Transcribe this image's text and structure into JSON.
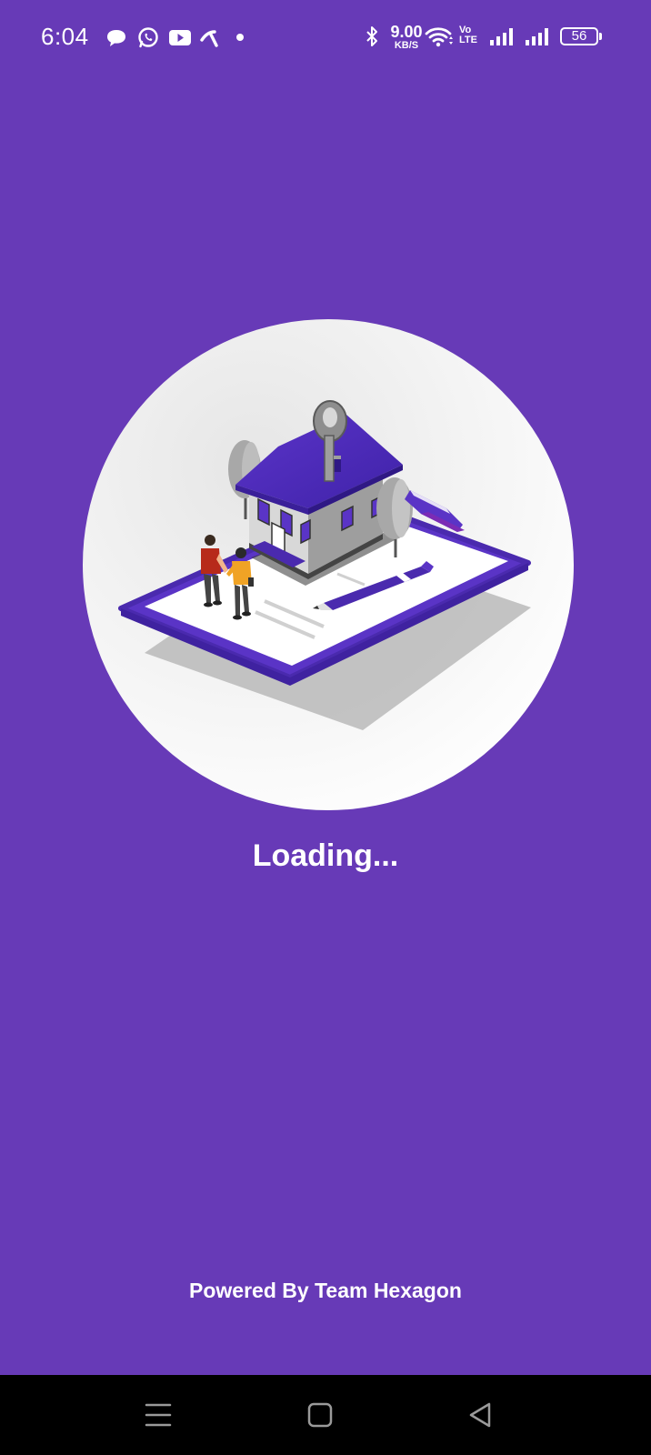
{
  "status_bar": {
    "time": "6:04",
    "net_speed_value": "9.00",
    "net_speed_unit": "KB/S",
    "volte_line1": "Vo",
    "volte_line2": "LTE",
    "battery_level": "56",
    "icons": [
      "chat-bubble-icon",
      "whatsapp-icon",
      "youtube-icon",
      "telenor-icon",
      "dot-icon",
      "bluetooth-icon",
      "wifi-icon",
      "signal-icon",
      "signal-icon",
      "battery-icon"
    ]
  },
  "splash": {
    "loading_text": "Loading...",
    "powered_by_text": "Powered By Team Hexagon",
    "illustration": "real-estate-house-on-tablet-illustration"
  },
  "nav_bar": {
    "icons": [
      "menu-icon",
      "home-icon",
      "back-icon"
    ]
  },
  "colors": {
    "background": "#673AB7",
    "accent": "#4A2DB0",
    "nav_background": "#000000",
    "text": "#FFFFFF"
  }
}
